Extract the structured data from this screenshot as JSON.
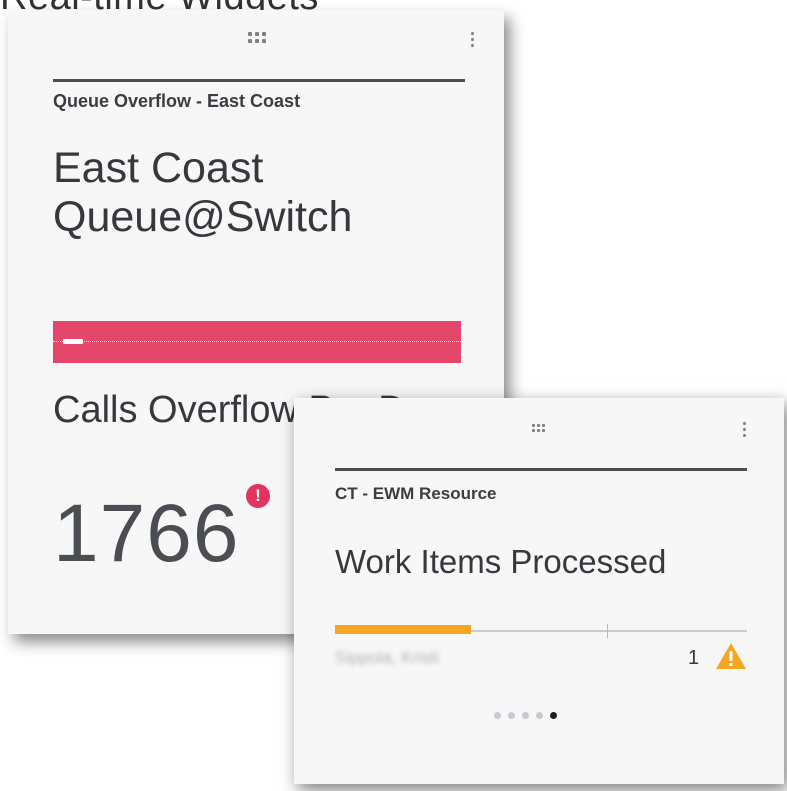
{
  "header_fragment": "Real-time Widgets",
  "card1": {
    "label": "Queue Overflow - East Coast",
    "title": "East Coast Queue@Switch",
    "metric_label": "Calls Overflow Per Day",
    "metric_value": "1766",
    "alert_symbol": "!",
    "bar_color": "#e4476a",
    "bar_marker_fraction": 0.05,
    "icons": {
      "drag": "drag-grid-icon",
      "menu": "kebab-menu-icon",
      "alert": "error-circle-icon"
    }
  },
  "card2": {
    "label": "CT - EWM Resource",
    "title": "Work Items Processed",
    "progress_fraction": 0.33,
    "progress_color": "#f5a623",
    "tick_fraction": 0.66,
    "row": {
      "name": "Sippola, Kristi",
      "count": "1",
      "status_icon": "warning-triangle-icon",
      "status_color": "#f5a623"
    },
    "pager": {
      "pages": 5,
      "active_index": 4
    },
    "icons": {
      "drag": "drag-grid-icon",
      "menu": "kebab-menu-icon"
    }
  }
}
